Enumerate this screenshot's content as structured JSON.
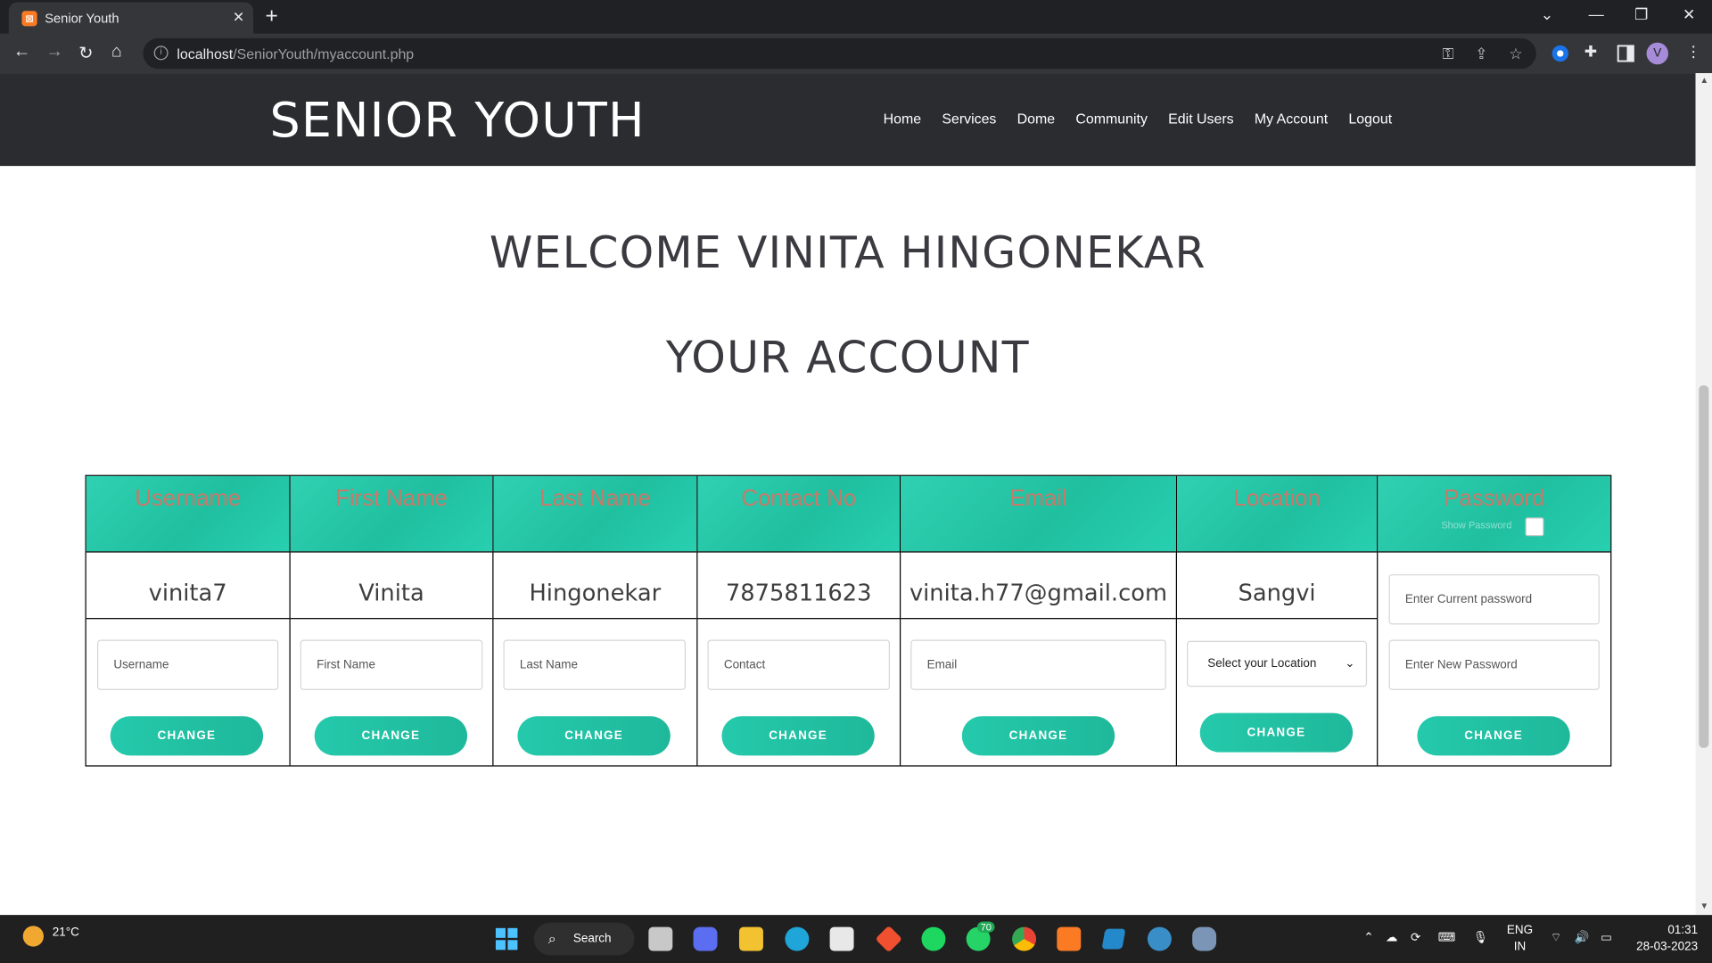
{
  "browser": {
    "tab_title": "Senior Youth",
    "tab_favicon": "xampp-icon",
    "url_host": "localhost",
    "url_path": "/SeniorYouth/myaccount.php",
    "profile_initial": "V"
  },
  "site": {
    "logo": "SENIOR YOUTH",
    "nav": [
      "Home",
      "Services",
      "Dome",
      "Community",
      "Edit Users",
      "My Account",
      "Logout"
    ]
  },
  "main": {
    "welcome": "WELCOME VINITA HINGONEKAR",
    "account_title": "YOUR ACCOUNT"
  },
  "account": {
    "columns": [
      {
        "header": "Username",
        "value": "vinita7",
        "placeholder": "Username",
        "button": "CHANGE"
      },
      {
        "header": "First Name",
        "value": "Vinita",
        "placeholder": "First Name",
        "button": "CHANGE"
      },
      {
        "header": "Last Name",
        "value": "Hingonekar",
        "placeholder": "Last Name",
        "button": "CHANGE"
      },
      {
        "header": "Contact No",
        "value": "7875811623",
        "placeholder": "Contact",
        "button": "CHANGE"
      },
      {
        "header": "Email",
        "value": "vinita.h77@gmail.com",
        "placeholder": "Email",
        "button": "CHANGE"
      },
      {
        "header": "Location",
        "value": "Sangvi",
        "select_value": "Select your Location",
        "button": "CHANGE"
      },
      {
        "header": "Password",
        "show_password_label": "Show Password",
        "current_placeholder": "Enter Current password",
        "new_placeholder": "Enter New Password",
        "button": "CHANGE"
      }
    ]
  },
  "taskbar": {
    "weather": "21°C",
    "search_label": "Search",
    "whatsapp_badge": "70",
    "lang_line1": "ENG",
    "lang_line2": "IN",
    "time": "01:31",
    "date": "28-03-2023"
  },
  "colors": {
    "header_bg": "#2a2c30",
    "table_header": "#26c9a9",
    "header_text": "#c9796a",
    "button": "#22c0a2"
  }
}
